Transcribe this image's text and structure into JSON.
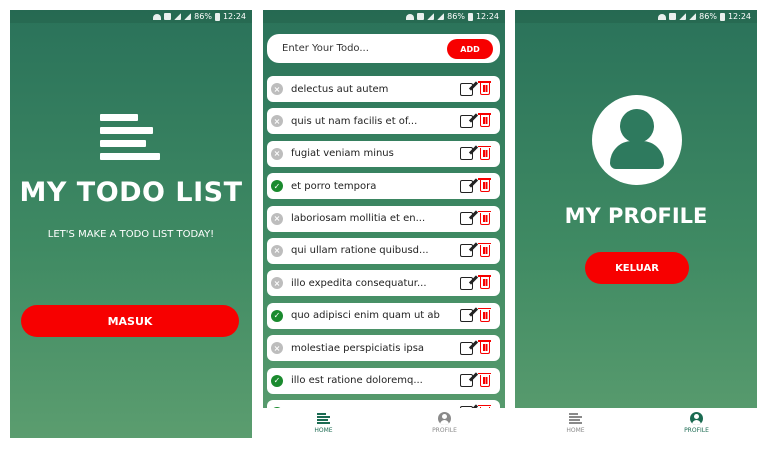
{
  "statusbar": {
    "battery": "86%",
    "time": "12:24"
  },
  "screen_login": {
    "title": "MY TODO LIST",
    "subtitle": "LET'S MAKE A TODO LIST TODAY!",
    "button": "MASUK",
    "logo_icon": "todo-list-icon"
  },
  "screen_todos": {
    "input_placeholder": "Enter Your Todo...",
    "add_button": "ADD",
    "todos": [
      {
        "text": "delectus aut autem",
        "done": false
      },
      {
        "text": "quis ut nam facilis et of...",
        "done": false
      },
      {
        "text": "fugiat veniam minus",
        "done": false
      },
      {
        "text": "et porro tempora",
        "done": true
      },
      {
        "text": "laboriosam mollitia et en...",
        "done": false
      },
      {
        "text": "qui ullam ratione quibusd...",
        "done": false
      },
      {
        "text": "illo expedita consequatur...",
        "done": false
      },
      {
        "text": "quo adipisci enim quam ut ab",
        "done": true
      },
      {
        "text": "molestiae perspiciatis ipsa",
        "done": false
      },
      {
        "text": "illo est ratione doloremq...",
        "done": true
      },
      {
        "text": "",
        "done": true
      }
    ],
    "nav": {
      "home": "HOME",
      "profile": "PROFILE",
      "active": "home"
    }
  },
  "screen_profile": {
    "title": "MY PROFILE",
    "button": "KELUAR",
    "nav": {
      "home": "HOME",
      "profile": "PROFILE",
      "active": "profile"
    }
  },
  "colors": {
    "accent_red": "#f70000",
    "green_dark": "#2a725a",
    "green_light": "#5b9d6f",
    "done_green": "#1a8a2e"
  }
}
